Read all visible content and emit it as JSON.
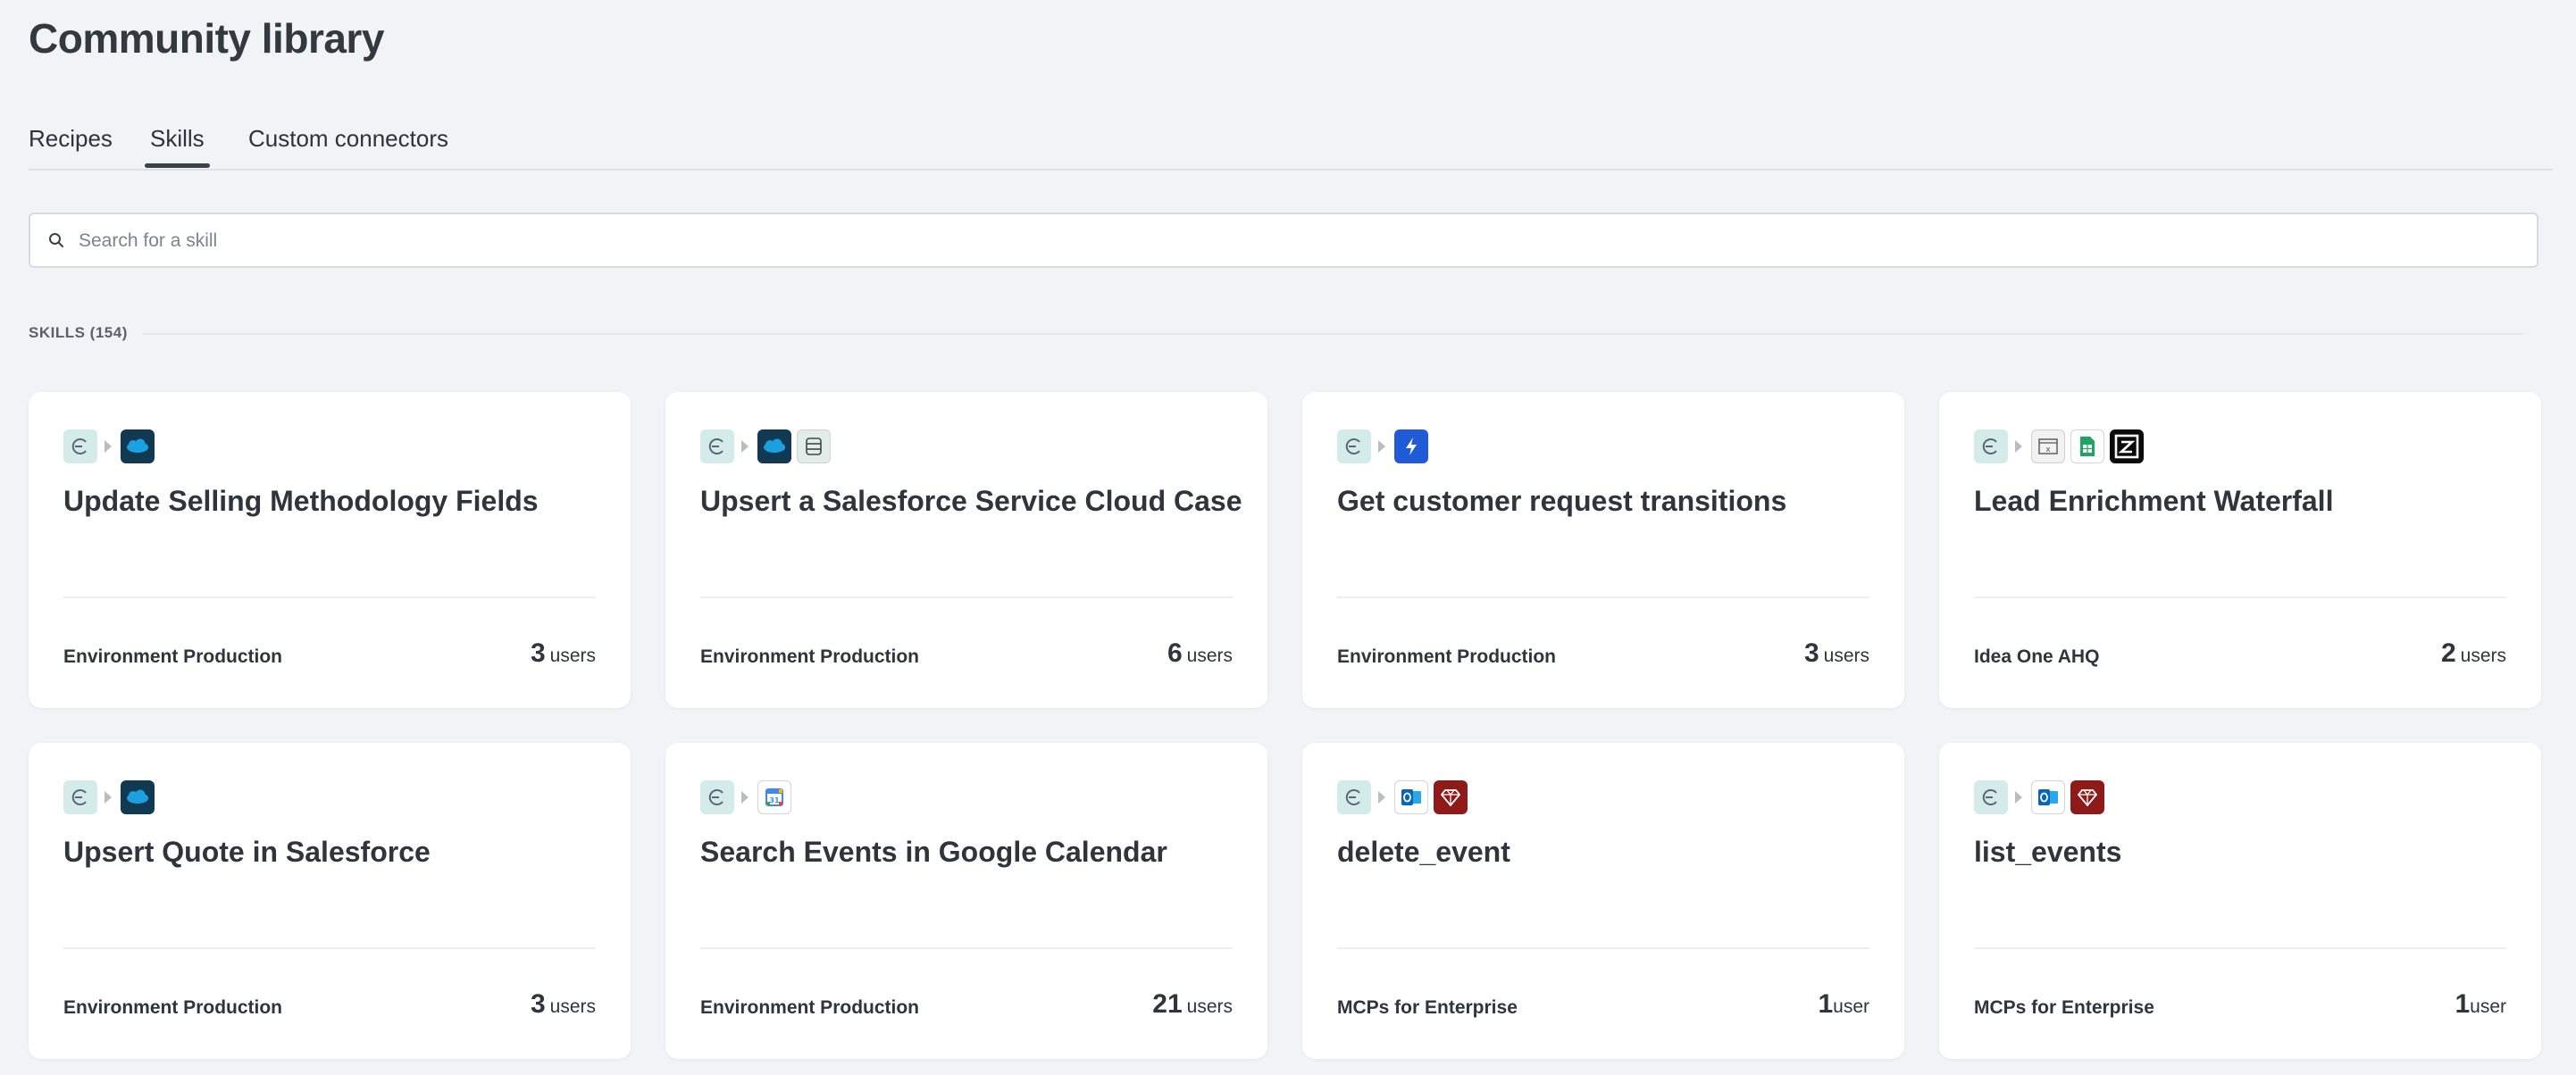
{
  "page": {
    "title": "Community library"
  },
  "tabs": [
    {
      "label": "Recipes",
      "active": false
    },
    {
      "label": "Skills",
      "active": true
    },
    {
      "label": "Custom connectors",
      "active": false
    }
  ],
  "search": {
    "placeholder": "Search for a skill",
    "value": ""
  },
  "section": {
    "label": "SKILLS (154)"
  },
  "colors": {
    "background": "#f1f3f7",
    "card": "#ffffff",
    "text": "#2c333a",
    "tab_indicator": "#3b434a"
  },
  "cards": [
    {
      "icons": [
        "workato-icon",
        "salesforce-icon"
      ],
      "title": "Update Selling Methodology Fields",
      "env": "Environment Production",
      "users": "3",
      "users_label": "users"
    },
    {
      "icons": [
        "workato-icon",
        "salesforce-icon",
        "database-icon"
      ],
      "title": "Upsert a Salesforce Service Cloud Case",
      "env": "Environment Production",
      "users": "6",
      "users_label": "users"
    },
    {
      "icons": [
        "workato-icon",
        "jira-service-management-icon"
      ],
      "title": "Get customer request transitions",
      "env": "Environment Production",
      "users": "3",
      "users_label": "users"
    },
    {
      "icons": [
        "workato-icon",
        "spreadsheet-icon",
        "google-sheets-icon",
        "zoominfo-icon"
      ],
      "title": "Lead Enrichment Waterfall",
      "env": "Idea One AHQ",
      "users": "2",
      "users_label": "users"
    },
    {
      "icons": [
        "workato-icon",
        "salesforce-icon"
      ],
      "title": "Upsert Quote in Salesforce",
      "env": "Environment Production",
      "users": "3",
      "users_label": "users"
    },
    {
      "icons": [
        "workato-icon",
        "google-calendar-icon"
      ],
      "title": "Search Events in Google Calendar",
      "env": "Environment Production",
      "users": "21",
      "users_label": "users"
    },
    {
      "icons": [
        "workato-icon",
        "outlook-icon",
        "ruby-icon"
      ],
      "title": "delete_event",
      "env": "MCPs for Enterprise",
      "users": "1",
      "users_label": "user"
    },
    {
      "icons": [
        "workato-icon",
        "outlook-icon",
        "ruby-icon"
      ],
      "title": "list_events",
      "env": "MCPs for Enterprise",
      "users": "1",
      "users_label": "user"
    }
  ]
}
